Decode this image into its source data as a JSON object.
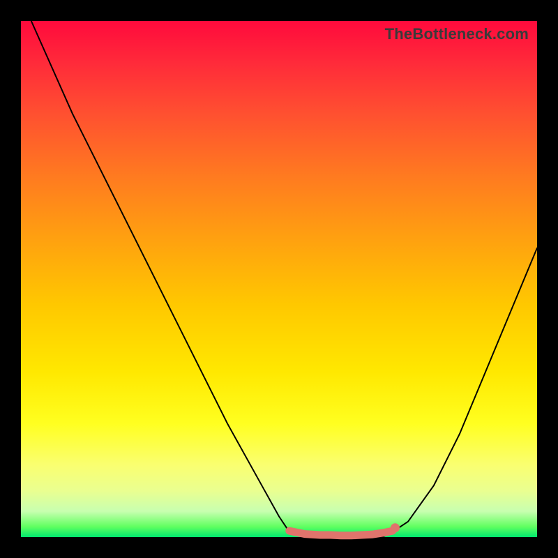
{
  "watermark": "TheBottleneck.com",
  "chart_data": {
    "type": "line",
    "title": "",
    "xlabel": "",
    "ylabel": "",
    "xlim": [
      0,
      100
    ],
    "ylim": [
      0,
      100
    ],
    "series": [
      {
        "name": "curve",
        "color": "#000000",
        "x": [
          2,
          10,
          20,
          30,
          40,
          50,
          52,
          55,
          58,
          62,
          66,
          70,
          72,
          75,
          80,
          85,
          90,
          95,
          100
        ],
        "y": [
          100,
          82,
          62,
          42,
          22,
          4,
          1,
          0,
          0,
          0,
          0,
          0,
          1,
          3,
          10,
          20,
          32,
          44,
          56
        ]
      }
    ],
    "highlight": {
      "name": "bottleneck-region",
      "color": "#e0746c",
      "x": [
        52,
        55,
        58,
        60,
        62,
        64,
        66,
        68,
        70,
        72
      ],
      "y": [
        1.2,
        0.6,
        0.4,
        0.4,
        0.3,
        0.3,
        0.4,
        0.5,
        0.8,
        1.2
      ]
    },
    "highlight_end_dot": {
      "x": 72.5,
      "y": 1.8
    }
  }
}
